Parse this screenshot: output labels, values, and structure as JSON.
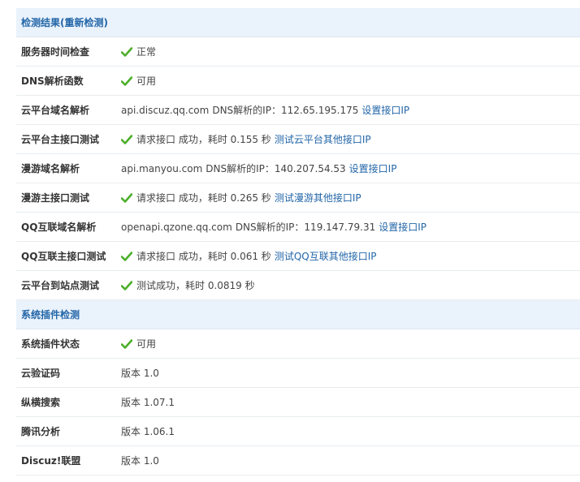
{
  "sections": {
    "detection": {
      "title": "检测结果(重新检测)",
      "rows": [
        {
          "label": "服务器时间检查",
          "status": "正常"
        },
        {
          "label": "DNS解析函数",
          "status": "可用"
        },
        {
          "label": "云平台域名解析",
          "host": "api.discuz.qq.com",
          "dns_text": "DNS解析的IP：112.65.195.175",
          "link": "设置接口IP"
        },
        {
          "label": "云平台主接口测试",
          "status": "请求接口 成功，耗时 0.155 秒",
          "link": "测试云平台其他接口IP"
        },
        {
          "label": "漫游域名解析",
          "host": "api.manyou.com",
          "dns_text": "DNS解析的IP：140.207.54.53",
          "link": "设置接口IP"
        },
        {
          "label": "漫游主接口测试",
          "status": "请求接口 成功，耗时 0.265 秒",
          "link": "测试漫游其他接口IP"
        },
        {
          "label": "QQ互联域名解析",
          "host": "openapi.qzone.qq.com",
          "dns_text": "DNS解析的IP：119.147.79.31",
          "link": "设置接口IP"
        },
        {
          "label": "QQ互联主接口测试",
          "status": "请求接口 成功，耗时 0.061 秒",
          "link": "测试QQ互联其他接口IP"
        },
        {
          "label": "云平台到站点测试",
          "status": "测试成功，耗时 0.0819 秒"
        }
      ]
    },
    "plugins": {
      "title": "系统插件检测",
      "rows": [
        {
          "label": "系统插件状态",
          "status": "可用"
        },
        {
          "label": "云验证码",
          "version": "版本 1.0"
        },
        {
          "label": "纵横搜索",
          "version": "版本 1.07.1"
        },
        {
          "label": "腾讯分析",
          "version": "版本 1.06.1"
        },
        {
          "label": "Discuz!联盟",
          "version": "版本 1.0"
        }
      ]
    }
  },
  "colors": {
    "header_bg": "#eaf2fb",
    "accent": "#2366a8",
    "check": "#4cae2a"
  }
}
